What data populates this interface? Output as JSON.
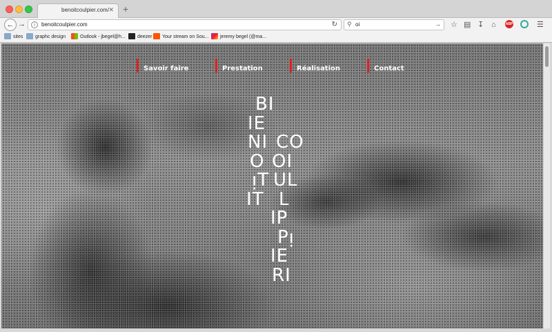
{
  "browser": {
    "tab_title": "benoitcoulpier.com/",
    "tab_close": "✕",
    "new_tab": "+",
    "url": "benoitcoulpier.com",
    "search_value": "oi",
    "icons": [
      "back-arrow",
      "forward-arrow",
      "info",
      "reload",
      "search",
      "star",
      "reading-list",
      "download",
      "home",
      "adblock",
      "ghostery",
      "menu"
    ]
  },
  "bookmarks": [
    {
      "label": "sites",
      "icon": "folder"
    },
    {
      "label": "graphc design",
      "icon": "folder"
    },
    {
      "label": "Outlook - jbegel@h...",
      "icon": "microsoft"
    },
    {
      "label": "deezer",
      "icon": "deezer"
    },
    {
      "label": "Your stream on Sou...",
      "icon": "soundcloud"
    },
    {
      "label": "jeremy begel (@ma...",
      "icon": "instagram"
    }
  ],
  "nav": {
    "items": [
      {
        "label": "Savoir faire"
      },
      {
        "label": "Prestation"
      },
      {
        "label": "Réalisation"
      },
      {
        "label": "Contact"
      }
    ]
  },
  "hero": {
    "column_left": [
      "BI",
      "IE",
      "NI",
      "O",
      "ᴉT",
      "IT"
    ],
    "column_right": [
      "CO",
      "OI",
      "UL",
      "L",
      "IP",
      "Pᴉ",
      "IE",
      "RI"
    ]
  },
  "colors": {
    "accent": "#e02020",
    "nav_text": "#ffffff",
    "title_text": "#ffffff"
  }
}
